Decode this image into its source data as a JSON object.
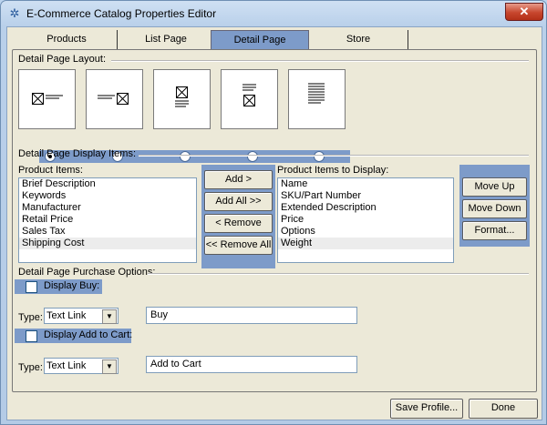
{
  "window": {
    "title": "E-Commerce Catalog Properties Editor",
    "close_glyph": "✕",
    "app_icon": "gear-icon"
  },
  "tabs": [
    "Products",
    "List Page",
    "Detail Page",
    "Store"
  ],
  "layout_section": {
    "label": "Detail Page Layout:",
    "options": [
      "image-left-text-right",
      "text-left-image-right",
      "image-top-text-bottom",
      "text-top-image-bottom",
      "text-only"
    ],
    "selected_index": 0
  },
  "display_items": {
    "section_label": "Detail Page Display Items:",
    "product_items_label": "Product Items:",
    "product_items": [
      "Brief Description",
      "Keywords",
      "Manufacturer",
      "Retail Price",
      "Sales Tax",
      "Shipping Cost"
    ],
    "add_label": "Add >",
    "add_all_label": "Add All >>",
    "remove_label": "< Remove",
    "remove_all_label": "<< Remove All",
    "display_items_label": "Product Items to Display:",
    "display_items": [
      "Name",
      "SKU/Part Number",
      "Extended Description",
      "Price",
      "Options",
      "Weight"
    ],
    "move_up_label": "Move Up",
    "move_down_label": "Move Down",
    "format_label": "Format..."
  },
  "purchase": {
    "section_label": "Detail Page Purchase Options:",
    "display_buy_label": "Display Buy:",
    "display_buy_checked": false,
    "type_label": "Type:",
    "buy_type": "Text Link",
    "buy_text": "Buy",
    "display_cart_label": "Display Add to Cart:",
    "display_cart_checked": false,
    "cart_type_label": "Type:",
    "cart_type": "Text Link",
    "cart_text": "Add to Cart"
  },
  "footer": {
    "save_label": "Save Profile...",
    "done_label": "Done"
  },
  "colors": {
    "accent": "#7d9bc9",
    "window_frame": "#b9d0ea",
    "close": "#c7462d"
  }
}
